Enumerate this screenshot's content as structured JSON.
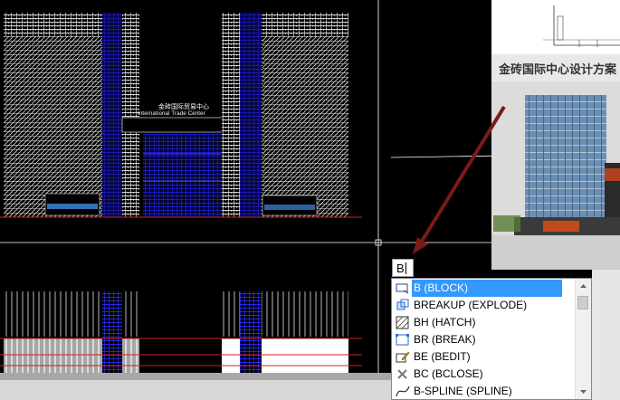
{
  "command_input": {
    "value": "B"
  },
  "photo": {
    "title": "金砖国际中心设计方案"
  },
  "drawing": {
    "sign_cn": "金砖国际贸易中心",
    "sign_en": "International Trade Center"
  },
  "autocomplete": {
    "items": [
      {
        "label": "B (BLOCK)",
        "icon": "block-icon",
        "selected": true
      },
      {
        "label": "BREAKUP (EXPLODE)",
        "icon": "explode-icon",
        "selected": false
      },
      {
        "label": "BH (HATCH)",
        "icon": "hatch-icon",
        "selected": false
      },
      {
        "label": "BR (BREAK)",
        "icon": "break-icon",
        "selected": false
      },
      {
        "label": "BE (BEDIT)",
        "icon": "block-edit-icon",
        "selected": false
      },
      {
        "label": "BC (BCLOSE)",
        "icon": "block-close-icon",
        "selected": false
      },
      {
        "label": "B-SPLINE (SPLINE)",
        "icon": "spline-icon",
        "selected": false
      }
    ]
  },
  "colors": {
    "selection": "#3399ff",
    "arrow": "#7a1a1a",
    "drawing_blue": "#1a1acc"
  }
}
